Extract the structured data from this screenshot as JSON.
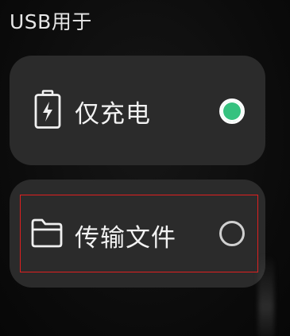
{
  "header": {
    "title": "USB用于"
  },
  "options": [
    {
      "label": "仅充电",
      "icon": "battery-charging-icon",
      "selected": true
    },
    {
      "label": "传输文件",
      "icon": "folder-icon",
      "selected": false
    }
  ],
  "colors": {
    "background": "#0b0b0b",
    "card": "#2b2b2b",
    "selected_radio": "#35c27f",
    "highlight_box": "#e02020"
  }
}
